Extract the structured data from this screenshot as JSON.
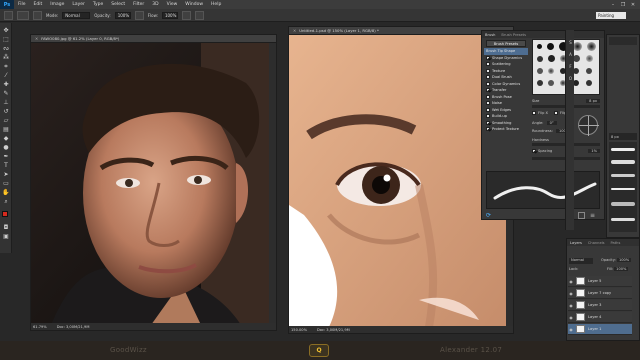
{
  "app": {
    "logo": "Ps"
  },
  "menu": [
    "File",
    "Edit",
    "Image",
    "Layer",
    "Type",
    "Select",
    "Filter",
    "3D",
    "View",
    "Window",
    "Help"
  ],
  "window_controls": [
    "–",
    "❐",
    "✕"
  ],
  "options": {
    "mode_label": "Mode:",
    "mode_value": "Normal",
    "opacity_label": "Opacity:",
    "opacity_value": "100%",
    "flow_label": "Flow:",
    "flow_value": "100%",
    "workspace": "Painting"
  },
  "doc1": {
    "tab": "FAWO080.jpg @ 61.2% (Layer 0, RGB/8*)",
    "zoom": "61.79%",
    "doc_info": "Doc: 3,00M/21,9M"
  },
  "doc2": {
    "tab": "Untitled-1.psd @ 150% (Layer 1, RGB/8) *",
    "zoom": "150.00%",
    "doc_info": "Doc: 3,00M/21,9M"
  },
  "brush_panel": {
    "tabs": [
      "Brush",
      "Brush Presets"
    ],
    "presets_button": "Brush Presets",
    "items": [
      {
        "label": "Brush Tip Shape",
        "checked": false
      },
      {
        "label": "Shape Dynamics",
        "checked": true
      },
      {
        "label": "Scattering",
        "checked": false
      },
      {
        "label": "Texture",
        "checked": false
      },
      {
        "label": "Dual Brush",
        "checked": false
      },
      {
        "label": "Color Dynamics",
        "checked": false
      },
      {
        "label": "Transfer",
        "checked": true
      },
      {
        "label": "Brush Pose",
        "checked": false
      },
      {
        "label": "Noise",
        "checked": false
      },
      {
        "label": "Wet Edges",
        "checked": false
      },
      {
        "label": "Build-up",
        "checked": false
      },
      {
        "label": "Smoothing",
        "checked": true
      },
      {
        "label": "Protect Texture",
        "checked": true
      }
    ],
    "size_label": "Size",
    "size_value": "8 px",
    "flip_x": "Flip X",
    "flip_y": "Flip Y",
    "angle_label": "Angle:",
    "angle_value": "0°",
    "roundness_label": "Roundness:",
    "roundness_value": "100%",
    "hardness_label": "Hardness",
    "spacing_label": "Spacing",
    "spacing_value": "1%"
  },
  "layers_panel": {
    "tabs": [
      "Layers",
      "Channels",
      "Paths"
    ],
    "blend_mode": "Normal",
    "opacity_label": "Opacity:",
    "opacity_value": "100%",
    "lock_label": "Lock:",
    "fill_label": "Fill:",
    "fill_value": "100%",
    "layers": [
      {
        "name": "Layer 5",
        "selected": false
      },
      {
        "name": "Layer 7 copy",
        "selected": false
      },
      {
        "name": "Layer 3",
        "selected": false
      },
      {
        "name": "Layer 4",
        "selected": false
      },
      {
        "name": "Layer 1",
        "selected": true
      }
    ]
  },
  "right_strip": {
    "size_value": "8 px",
    "items": [
      "S",
      "A",
      "F",
      "O"
    ]
  },
  "taskbar": {
    "left_text": "GoodWizz",
    "badge": "Q",
    "right_text": "Alexander 12.07"
  }
}
